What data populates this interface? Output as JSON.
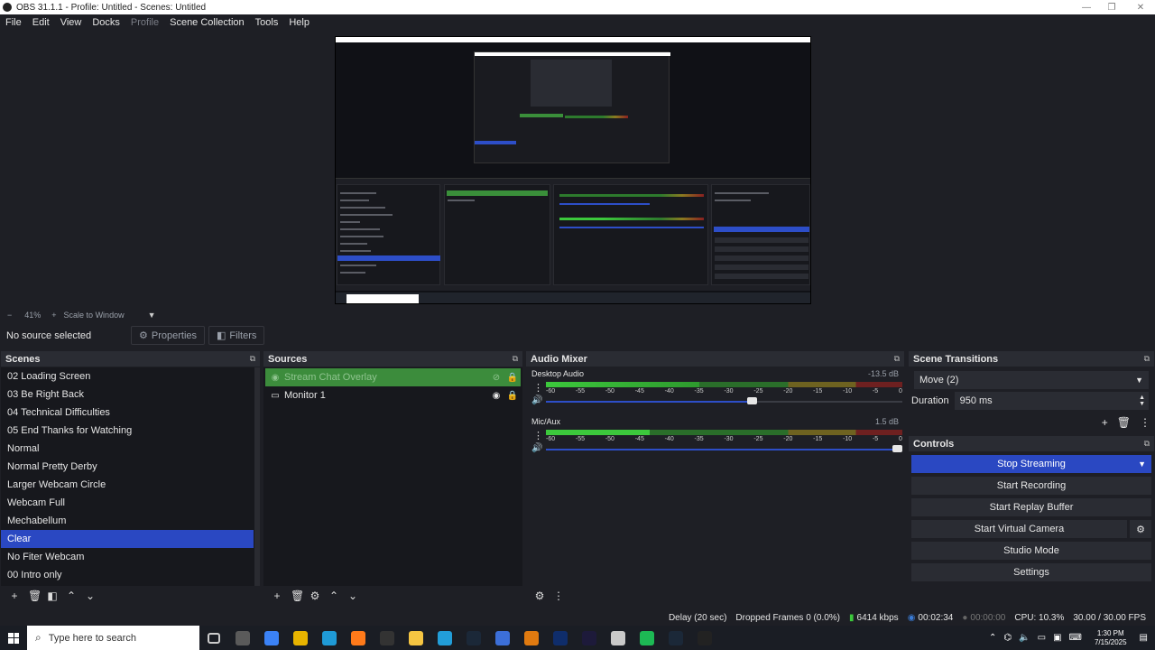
{
  "window": {
    "title": "OBS 31.1.1 - Profile: Untitled - Scenes: Untitled"
  },
  "menu": [
    "File",
    "Edit",
    "View",
    "Docks",
    "Profile",
    "Scene Collection",
    "Tools",
    "Help"
  ],
  "zoom": {
    "minus": "−",
    "level": "41%",
    "plus": "+",
    "mode": "Scale to Window"
  },
  "source_toolbar": {
    "no_source": "No source selected",
    "properties": "Properties",
    "filters": "Filters"
  },
  "scenes": {
    "title": "Scenes",
    "items": [
      "02 Loading Screen",
      "03 Be Right Back",
      "04 Technical Difficulties",
      "05 End Thanks for Watching",
      "Normal",
      "Normal Pretty Derby",
      "Larger Webcam Circle",
      "Webcam Full",
      "Mechabellum",
      "Clear",
      "No Fiter Webcam",
      "00 Intro only"
    ],
    "selected_index": 9
  },
  "sources": {
    "title": "Sources",
    "items": [
      {
        "label": "Stream Chat Overlay",
        "selected": true,
        "visible": false
      },
      {
        "label": "Monitor 1",
        "selected": false,
        "visible": true
      }
    ]
  },
  "mixer": {
    "title": "Audio Mixer",
    "channels": [
      {
        "name": "Desktop Audio",
        "db": "-13.5 dB",
        "level": 0.43,
        "volume": 0.58
      },
      {
        "name": "Mic/Aux",
        "db": "1.5 dB",
        "level": 0.29,
        "volume": 1.0
      }
    ],
    "ticks": [
      "-60",
      "-55",
      "-50",
      "-45",
      "-40",
      "-35",
      "-30",
      "-25",
      "-20",
      "-15",
      "-10",
      "-5",
      "0"
    ]
  },
  "transitions": {
    "title": "Scene Transitions",
    "selected": "Move (2)",
    "duration_label": "Duration",
    "duration_value": "950 ms"
  },
  "controls": {
    "title": "Controls",
    "stop_streaming": "Stop Streaming",
    "start_recording": "Start Recording",
    "start_replay": "Start Replay Buffer",
    "start_virtual_cam": "Start Virtual Camera",
    "studio_mode": "Studio Mode",
    "settings": "Settings"
  },
  "status": {
    "delay": "Delay (20 sec)",
    "dropped": "Dropped Frames 0 (0.0%)",
    "bitrate": "6414 kbps",
    "stream_time": "00:02:34",
    "rec_time": "00:00:00",
    "cpu": "CPU: 10.3%",
    "fps": "30.00 / 30.00 FPS"
  },
  "taskbar": {
    "search_placeholder": "Type here to search",
    "time": "1:30 PM",
    "date": "7/15/2025",
    "icon_colors": [
      "#3a7bd5",
      "#5a5a5a",
      "#3b82f6",
      "#e8b400",
      "#1f9ad6",
      "#ff7a1a",
      "#333333",
      "#f5c542",
      "#229ed9",
      "#1b2838",
      "#3c6fd8",
      "#e07a10",
      "#0f2d6b",
      "#1d1a3a",
      "#c9c9c9",
      "#1db954",
      "#1b2838",
      "#222222"
    ]
  },
  "colors": {
    "accent_blue": "#2a48c2",
    "source_green": "#3c8c3c"
  }
}
